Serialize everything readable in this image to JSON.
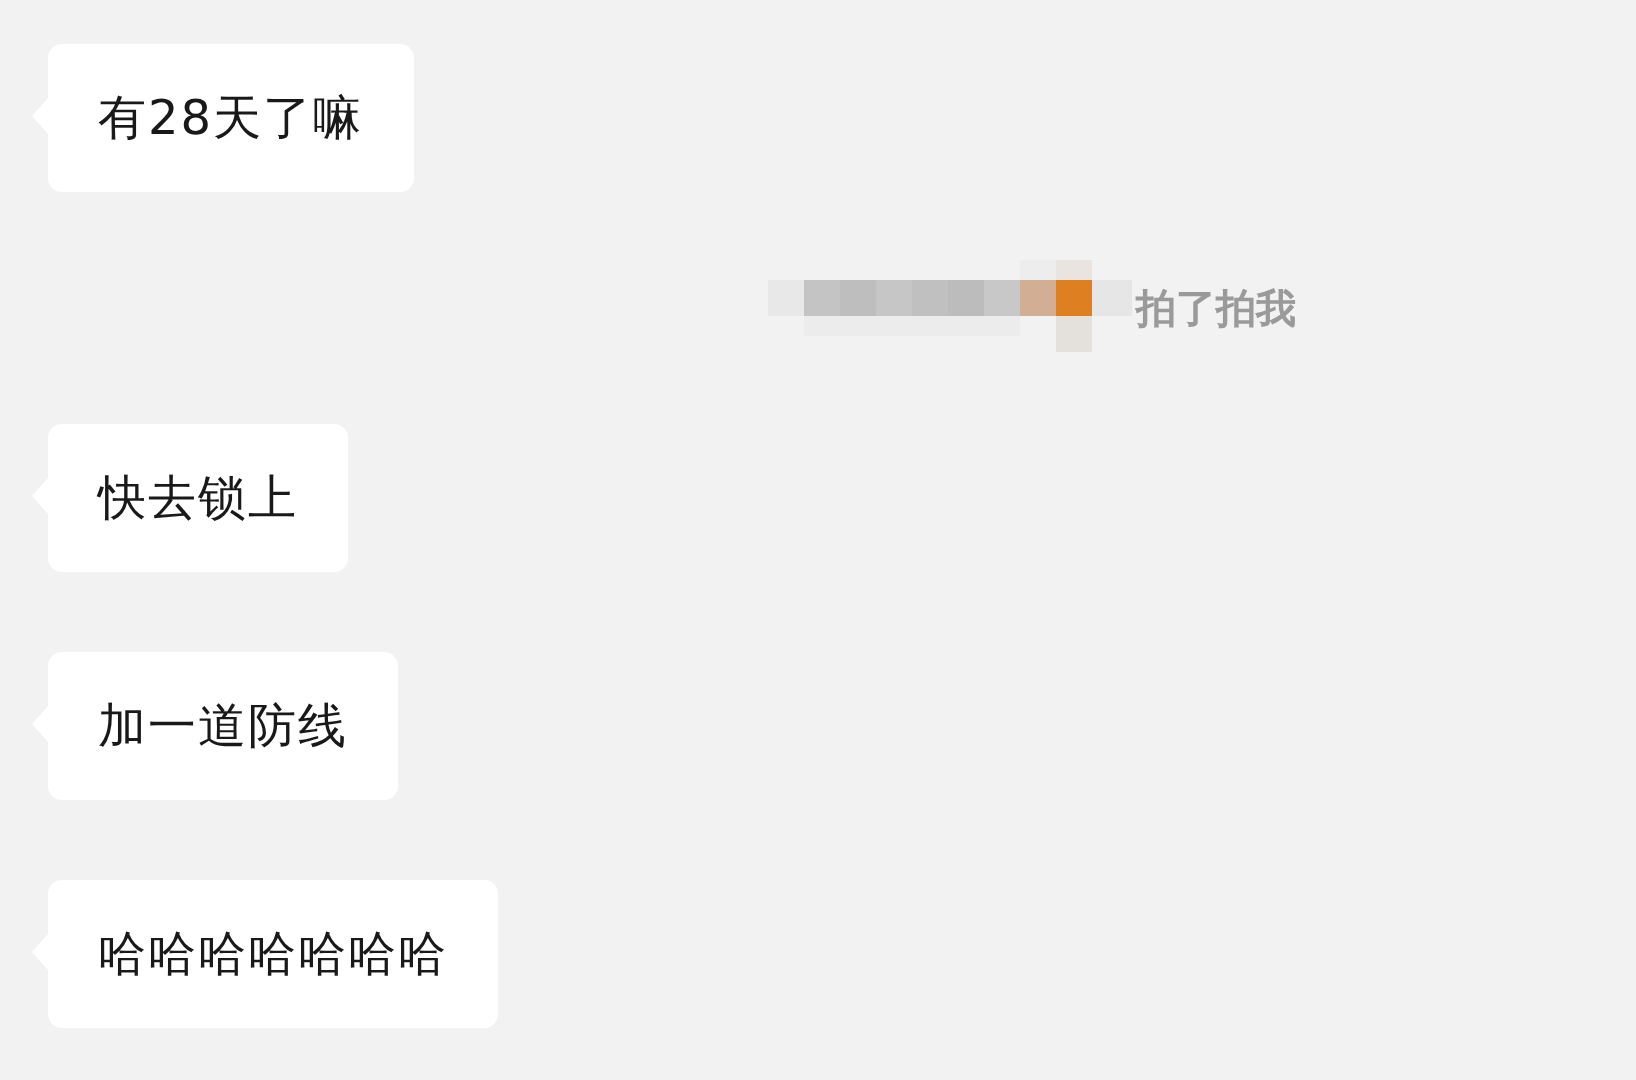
{
  "messages": [
    {
      "kind": "bubble",
      "text": "有28天了嘛"
    },
    {
      "kind": "pat",
      "text": "拍了拍我"
    },
    {
      "kind": "bubble",
      "text": "快去锁上"
    },
    {
      "kind": "bubble",
      "text": "加一道防线"
    },
    {
      "kind": "bubble",
      "text": "哈哈哈哈哈哈哈"
    }
  ]
}
